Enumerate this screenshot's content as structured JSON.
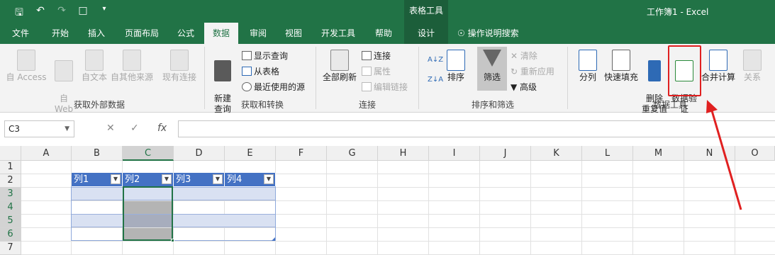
{
  "title_bar": {
    "context_tab_title": "表格工具",
    "document_title": "工作簿1  -  Excel",
    "qat_icons": [
      "save-icon",
      "undo-icon",
      "redo-icon",
      "new-file-icon",
      "customize-qat-icon"
    ]
  },
  "tabs": [
    "文件",
    "开始",
    "插入",
    "页面布局",
    "公式",
    "数据",
    "审阅",
    "视图",
    "开发工具",
    "帮助",
    "设计"
  ],
  "active_tab": "数据",
  "tell_me": "操作说明搜索",
  "ribbon": {
    "get_external": {
      "label": "获取外部数据",
      "buttons": [
        "自 Access",
        "自\nWeb",
        "自文本",
        "自其他来源",
        "现有连接"
      ]
    },
    "get_transform": {
      "label": "获取和转换",
      "new_query": "新建\n查询",
      "show_queries": "显示查询",
      "from_table": "从表格",
      "recent_sources": "最近使用的源"
    },
    "connections": {
      "label": "连接",
      "refresh_all": "全部刷新",
      "connections": "连接",
      "properties": "属性",
      "edit_links": "编辑链接"
    },
    "sort_filter": {
      "label": "排序和筛选",
      "sort": "排序",
      "filter": "筛选",
      "clear": "清除",
      "reapply": "重新应用",
      "advanced": "高级"
    },
    "data_tools": {
      "label": "数据工具",
      "text_to_columns": "分列",
      "flash_fill": "快速填充",
      "remove_duplicates": "删除\n重复值",
      "data_validation": "数据验\n证",
      "consolidate": "合并计算",
      "relationships": "关系"
    }
  },
  "formula_bar": {
    "name_box": "C3",
    "fx_label": "fx",
    "formula": ""
  },
  "grid": {
    "columns": [
      "A",
      "B",
      "C",
      "D",
      "E",
      "F",
      "G",
      "H",
      "I",
      "J",
      "K",
      "L",
      "M",
      "N",
      "O"
    ],
    "rows": [
      "1",
      "2",
      "3",
      "4",
      "5",
      "6",
      "7"
    ],
    "selected_column": "C",
    "table_headers": [
      "列1",
      "列2",
      "列3",
      "列4"
    ]
  },
  "colors": {
    "excel_green": "#217346",
    "table_header": "#4472c4",
    "band": "#d9e1f2",
    "highlight_red": "#e02020"
  }
}
